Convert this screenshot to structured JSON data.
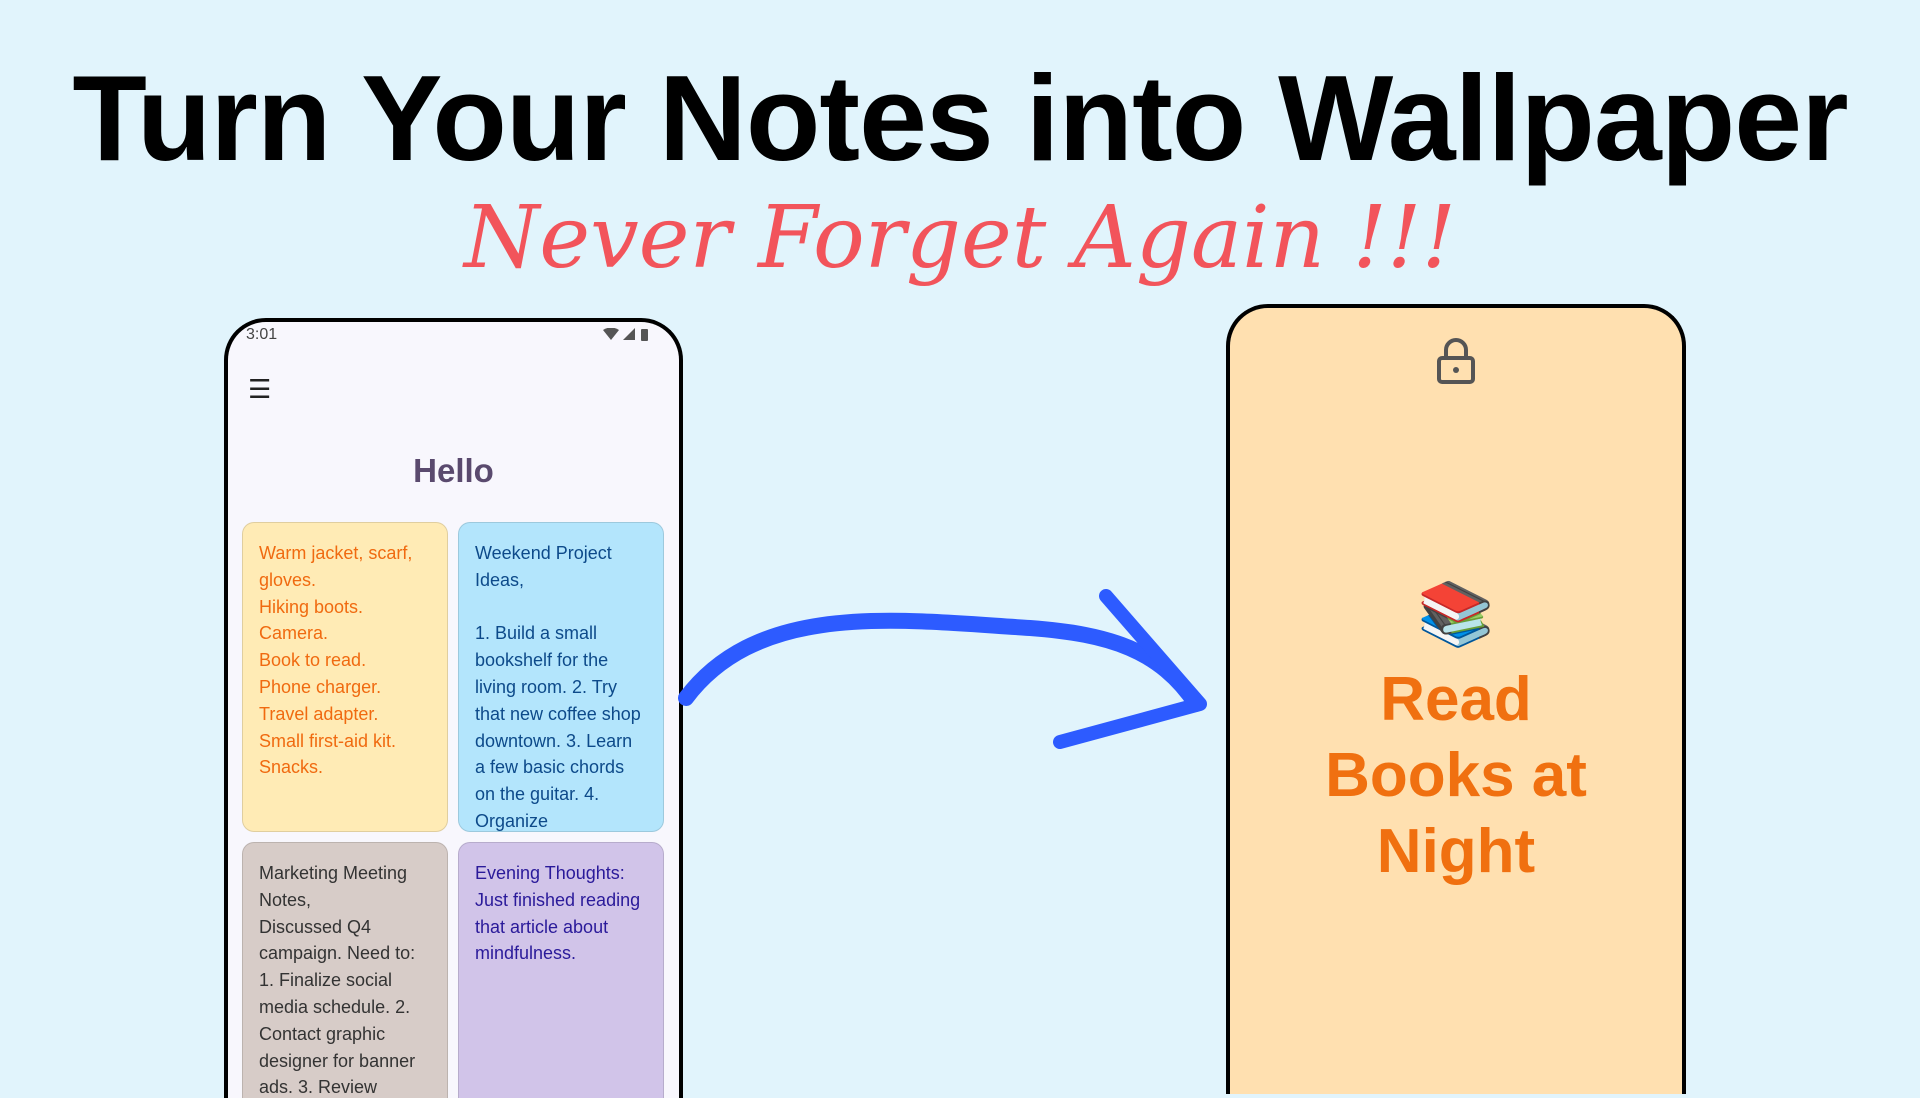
{
  "header": {
    "title": "Turn Your Notes into Wallpaper",
    "subtitle": "Never Forget Again !!!"
  },
  "app": {
    "status_time": "3:01",
    "status_icons": "wifi-icon signal-icon battery-icon",
    "greeting": "Hello",
    "notes": [
      {
        "text": "Warm jacket, scarf, gloves.\nHiking boots.\nCamera.\nBook to read.\nPhone charger.\nTravel adapter.\nSmall first-aid kit.\nSnacks.",
        "bg": "#ffebb5",
        "color": "#f06a10"
      },
      {
        "text": "Weekend Project Ideas,\n\n1. Build a small bookshelf for the living room. 2. Try that new coffee shop downtown. 3. Learn a few basic chords on the guitar. 4. Organize",
        "bg": "#b3e5fc",
        "color": "#0d4a8a"
      },
      {
        "text": "Marketing Meeting Notes,\nDiscussed Q4 campaign. Need to: 1. Finalize social media schedule. 2. Contact graphic designer for banner ads. 3. Review",
        "bg": "#d7ccc8",
        "color": "#333333"
      },
      {
        "text": "Evening Thoughts: Just finished reading that article about mindfulness.",
        "bg": "#d1c4e9",
        "color": "#2a1a9a"
      }
    ]
  },
  "wallpaper": {
    "emoji": "📚",
    "text": "Read Books at Night",
    "bg": "#ffe0b0",
    "color": "#f07010"
  },
  "colors": {
    "arrow": "#2d5bff",
    "subtitle": "#f2545b"
  }
}
